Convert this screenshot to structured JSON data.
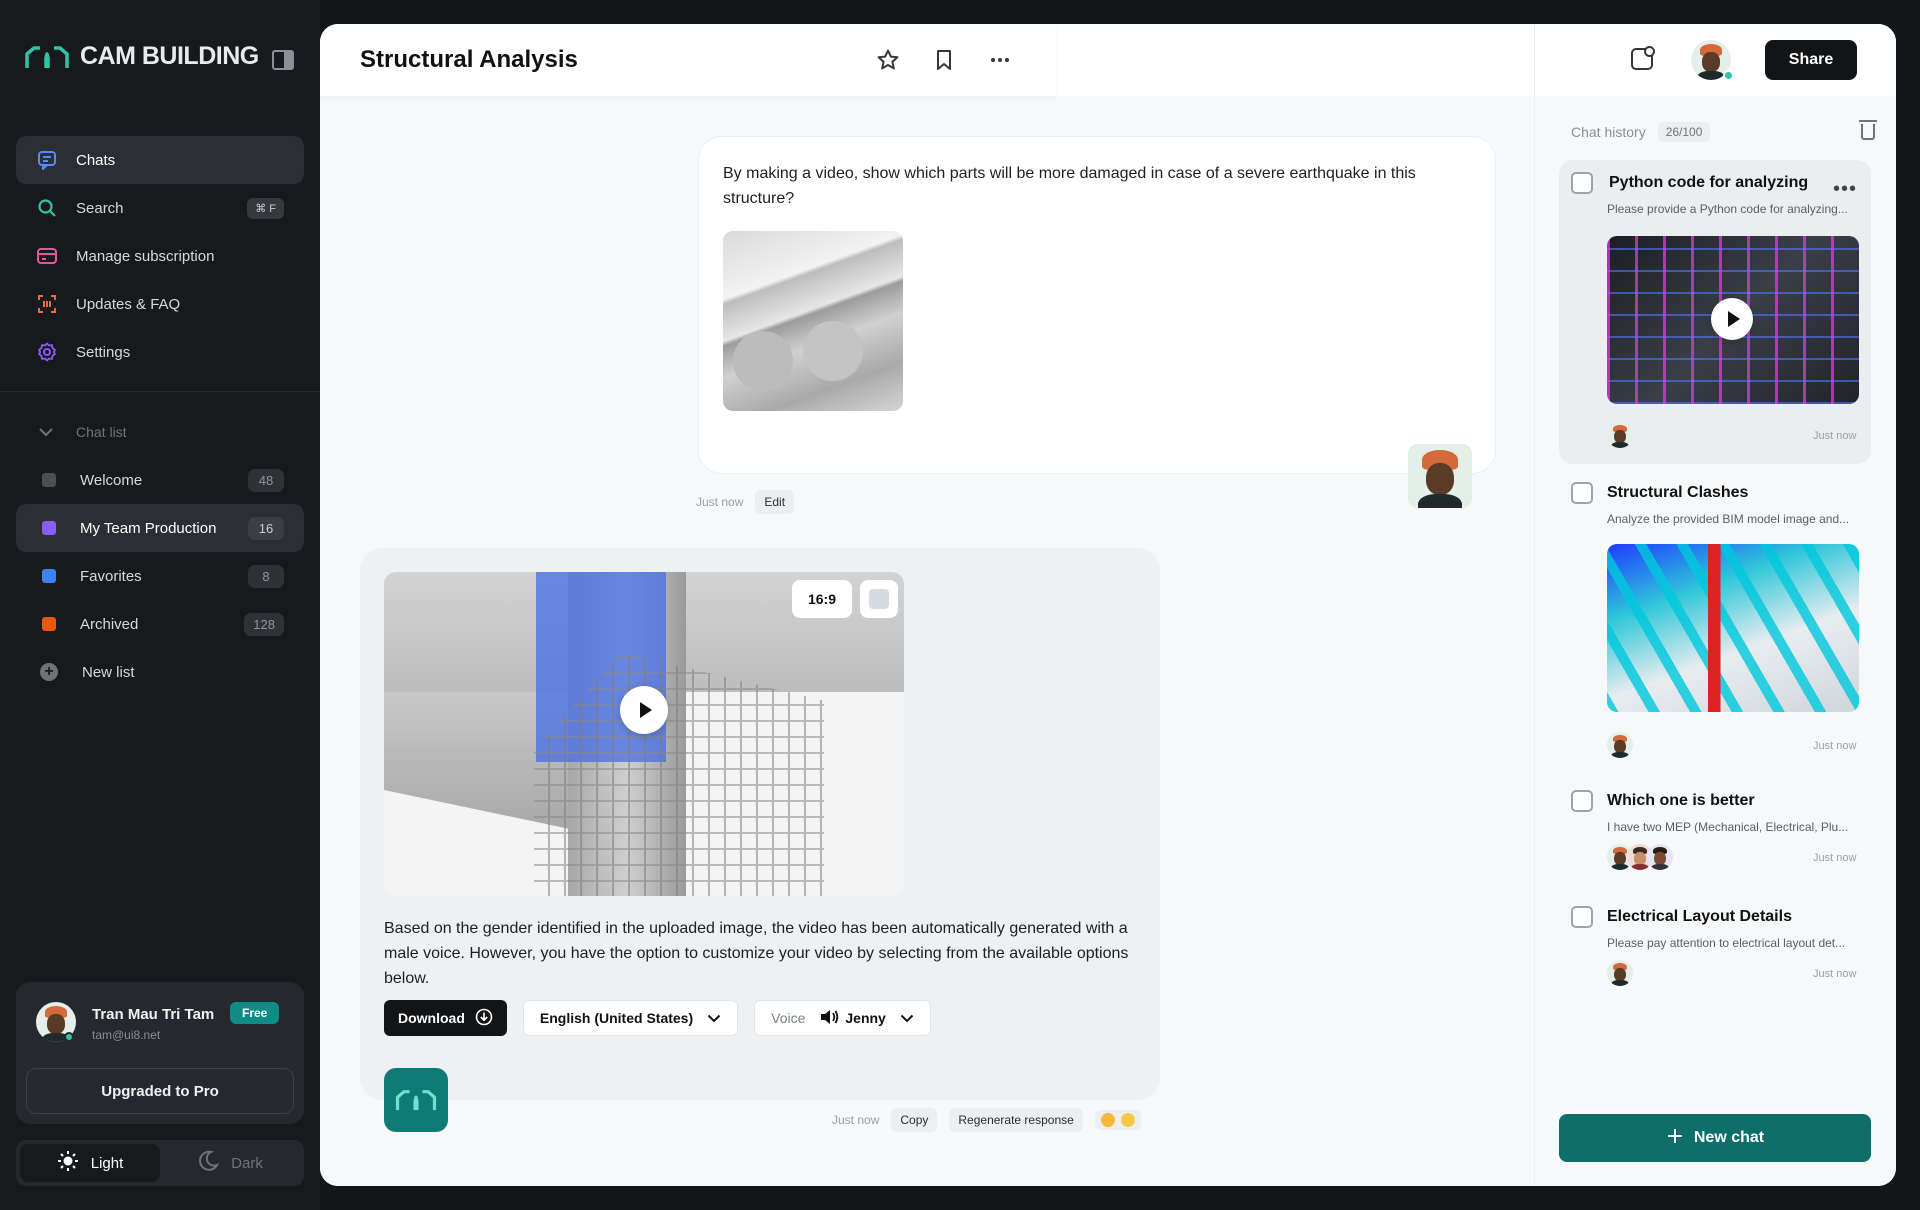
{
  "brand": {
    "name": "CAM BUILDING"
  },
  "nav": [
    {
      "label": "Chats",
      "icon": "chat-icon"
    },
    {
      "label": "Search",
      "icon": "search-icon",
      "shortcut": "⌘ F"
    },
    {
      "label": "Manage subscription",
      "icon": "card-icon"
    },
    {
      "label": "Updates & FAQ",
      "icon": "scan-icon"
    },
    {
      "label": "Settings",
      "icon": "gear-icon"
    }
  ],
  "chat_list": {
    "heading": "Chat list",
    "items": [
      {
        "label": "Welcome",
        "count": "48",
        "color": "#4a4d52"
      },
      {
        "label": "My Team Production",
        "count": "16",
        "color": "#8b5cf6"
      },
      {
        "label": "Favorites",
        "count": "8",
        "color": "#3b82f6"
      },
      {
        "label": "Archived",
        "count": "128",
        "color": "#ea580c"
      }
    ],
    "new_list": "New list"
  },
  "profile": {
    "name": "Tran Mau Tri Tam",
    "email": "tam@ui8.net",
    "plan": "Free",
    "upgrade_label": "Upgraded to Pro"
  },
  "theme": {
    "light": "Light",
    "dark": "Dark"
  },
  "header": {
    "title": "Structural Analysis"
  },
  "user_message": {
    "text": "By making a video, show which parts will be more damaged in case of a severe earthquake in this structure?",
    "time": "Just now",
    "edit_label": "Edit"
  },
  "ai_message": {
    "ratio": "16:9",
    "text": "Based on the gender identified in the uploaded image, the video has been automatically generated with a male voice. However, you have the option to customize your video by selecting from the available options below.",
    "download_label": "Download",
    "language": "English (United States)",
    "voice_label": "Voice",
    "voice": "Jenny",
    "time": "Just now",
    "copy_label": "Copy",
    "regenerate_label": "Regenerate response"
  },
  "right": {
    "share_label": "Share",
    "history_label": "Chat history",
    "history_count": "26/100",
    "cards": [
      {
        "title": "Python code for analyzing",
        "sub": "Please provide a Python code for analyzing...",
        "time": "Just now"
      },
      {
        "title": "Structural Clashes",
        "sub": "Analyze the provided BIM model image and...",
        "time": "Just now"
      },
      {
        "title": "Which one is better",
        "sub": "I have two MEP (Mechanical, Electrical, Plu...",
        "time": "Just now"
      },
      {
        "title": "Electrical Layout Details",
        "sub": "Please pay attention to electrical layout det...",
        "time": "Just now"
      }
    ],
    "new_chat_label": "New chat"
  },
  "colors": {
    "accent": "#0e6f6a",
    "dark": "#17191c"
  }
}
